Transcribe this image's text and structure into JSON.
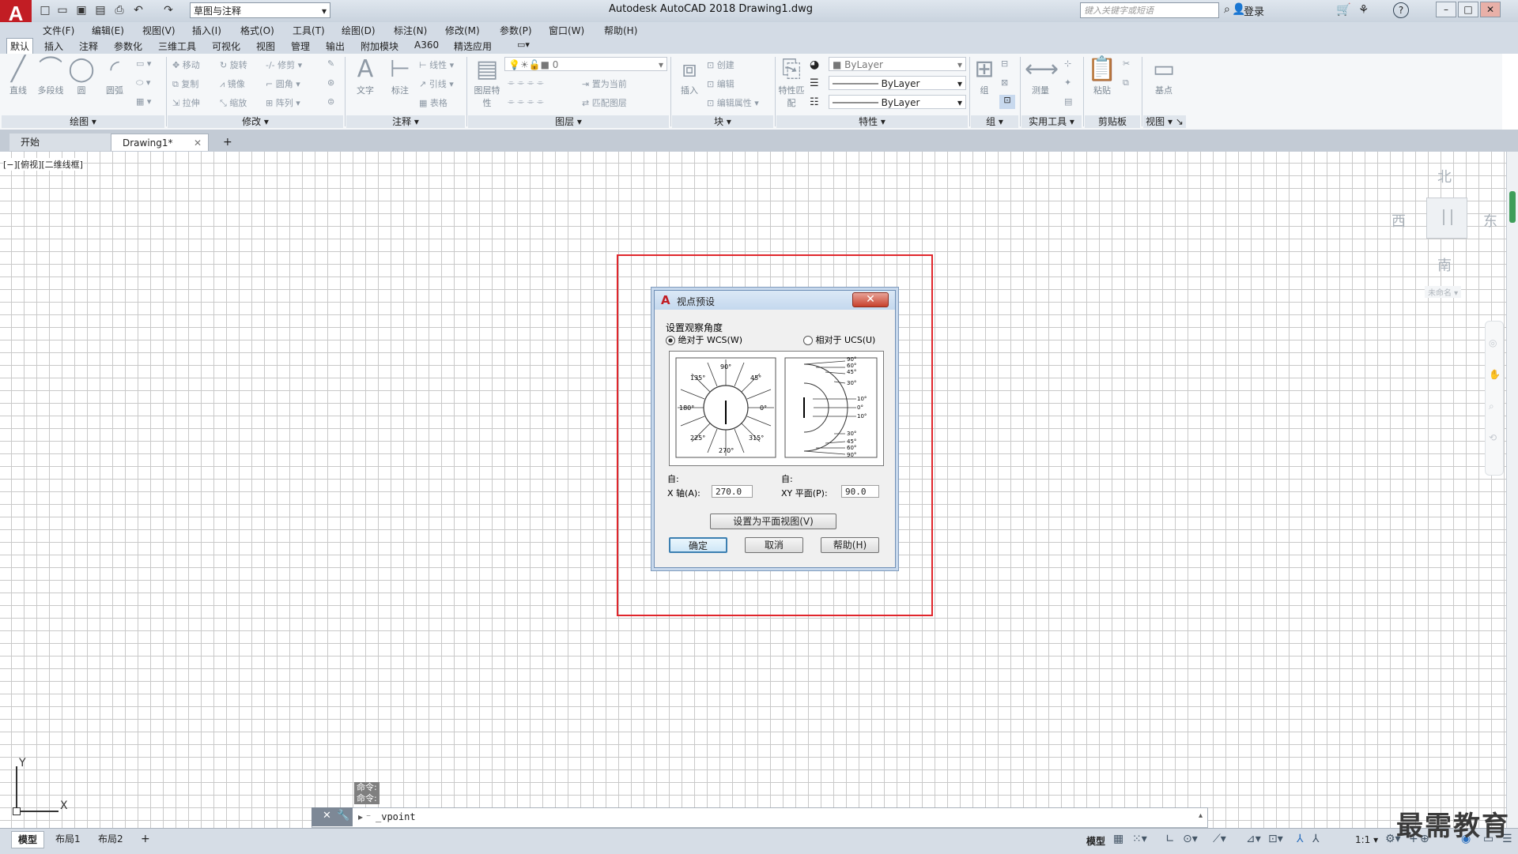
{
  "titlebar": {
    "app_title": "Autodesk AutoCAD 2018    Drawing1.dwg",
    "logo": "A",
    "workspace": "草图与注释",
    "search_placeholder": "键入关键字或短语",
    "login": "登录",
    "help": "?"
  },
  "menubar": [
    "文件(F)",
    "编辑(E)",
    "视图(V)",
    "插入(I)",
    "格式(O)",
    "工具(T)",
    "绘图(D)",
    "标注(N)",
    "修改(M)",
    "参数(P)",
    "窗口(W)",
    "帮助(H)"
  ],
  "ribbon_tabs": [
    "默认",
    "插入",
    "注释",
    "参数化",
    "三维工具",
    "可视化",
    "视图",
    "管理",
    "输出",
    "附加模块",
    "A360",
    "精选应用"
  ],
  "ribbon": {
    "draw": {
      "label": "绘图",
      "tools": [
        "直线",
        "多段线",
        "圆",
        "圆弧"
      ]
    },
    "modify": {
      "label": "修改",
      "tools": [
        "移动",
        "旋转",
        "修剪",
        "复制",
        "镜像",
        "圆角",
        "拉伸",
        "缩放",
        "阵列"
      ]
    },
    "annotation": {
      "label": "注释",
      "tools": [
        "文字",
        "标注",
        "线性",
        "引线",
        "表格"
      ]
    },
    "layers": {
      "label": "图层",
      "tools": [
        "图层特性",
        "置为当前",
        "匹配图层"
      ],
      "current": "0"
    },
    "block": {
      "label": "块",
      "tools": [
        "插入",
        "创建",
        "编辑",
        "编辑属性"
      ]
    },
    "properties": {
      "label": "特性",
      "tools": [
        "特性匹配"
      ],
      "color": "ByLayer",
      "linetype": "ByLayer",
      "lineweight": "ByLayer"
    },
    "groups": {
      "label": "组",
      "tools": [
        "组"
      ]
    },
    "utilities": {
      "label": "实用工具",
      "tools": [
        "测量"
      ]
    },
    "clipboard": {
      "label": "剪贴板",
      "tools": [
        "粘贴"
      ]
    },
    "view": {
      "label": "视图",
      "tools": [
        "基点"
      ]
    }
  },
  "doc_tabs": {
    "start": "开始",
    "drawing": "Drawing1*",
    "add": "+"
  },
  "viewport_label": "[−][俯视][二维线框]",
  "viewcube": {
    "north": "北",
    "south": "南",
    "east": "东",
    "west": "西",
    "ucs": "未命名"
  },
  "command": {
    "history": [
      "命令:",
      "命令:"
    ],
    "current": "_vpoint"
  },
  "status": {
    "tabs": [
      "模型",
      "布局1",
      "布局2"
    ],
    "add": "+",
    "model_btn": "模型",
    "scale": "1:1"
  },
  "dialog": {
    "title": "视点预设",
    "section": "设置观察角度",
    "radio_wcs": "绝对于 WCS(W)",
    "radio_ucs": "相对于 UCS(U)",
    "from_label_1": "自:",
    "x_axis_label": "X 轴(A):",
    "x_axis_value": "270.0",
    "from_label_2": "自:",
    "xy_plane_label": "XY 平面(P):",
    "xy_plane_value": "90.0",
    "plan_view_btn": "设置为平面视图(V)",
    "ok": "确定",
    "cancel": "取消",
    "help": "帮助(H)",
    "left_dial": [
      "90°",
      "45°",
      "0°",
      "315°",
      "270°",
      "225°",
      "180°",
      "135°"
    ],
    "right_dial": [
      "90°",
      "60°",
      "45°",
      "30°",
      "10°",
      "0°",
      "10°",
      "30°",
      "45°",
      "60°",
      "90°"
    ]
  },
  "watermark": "最需教育"
}
